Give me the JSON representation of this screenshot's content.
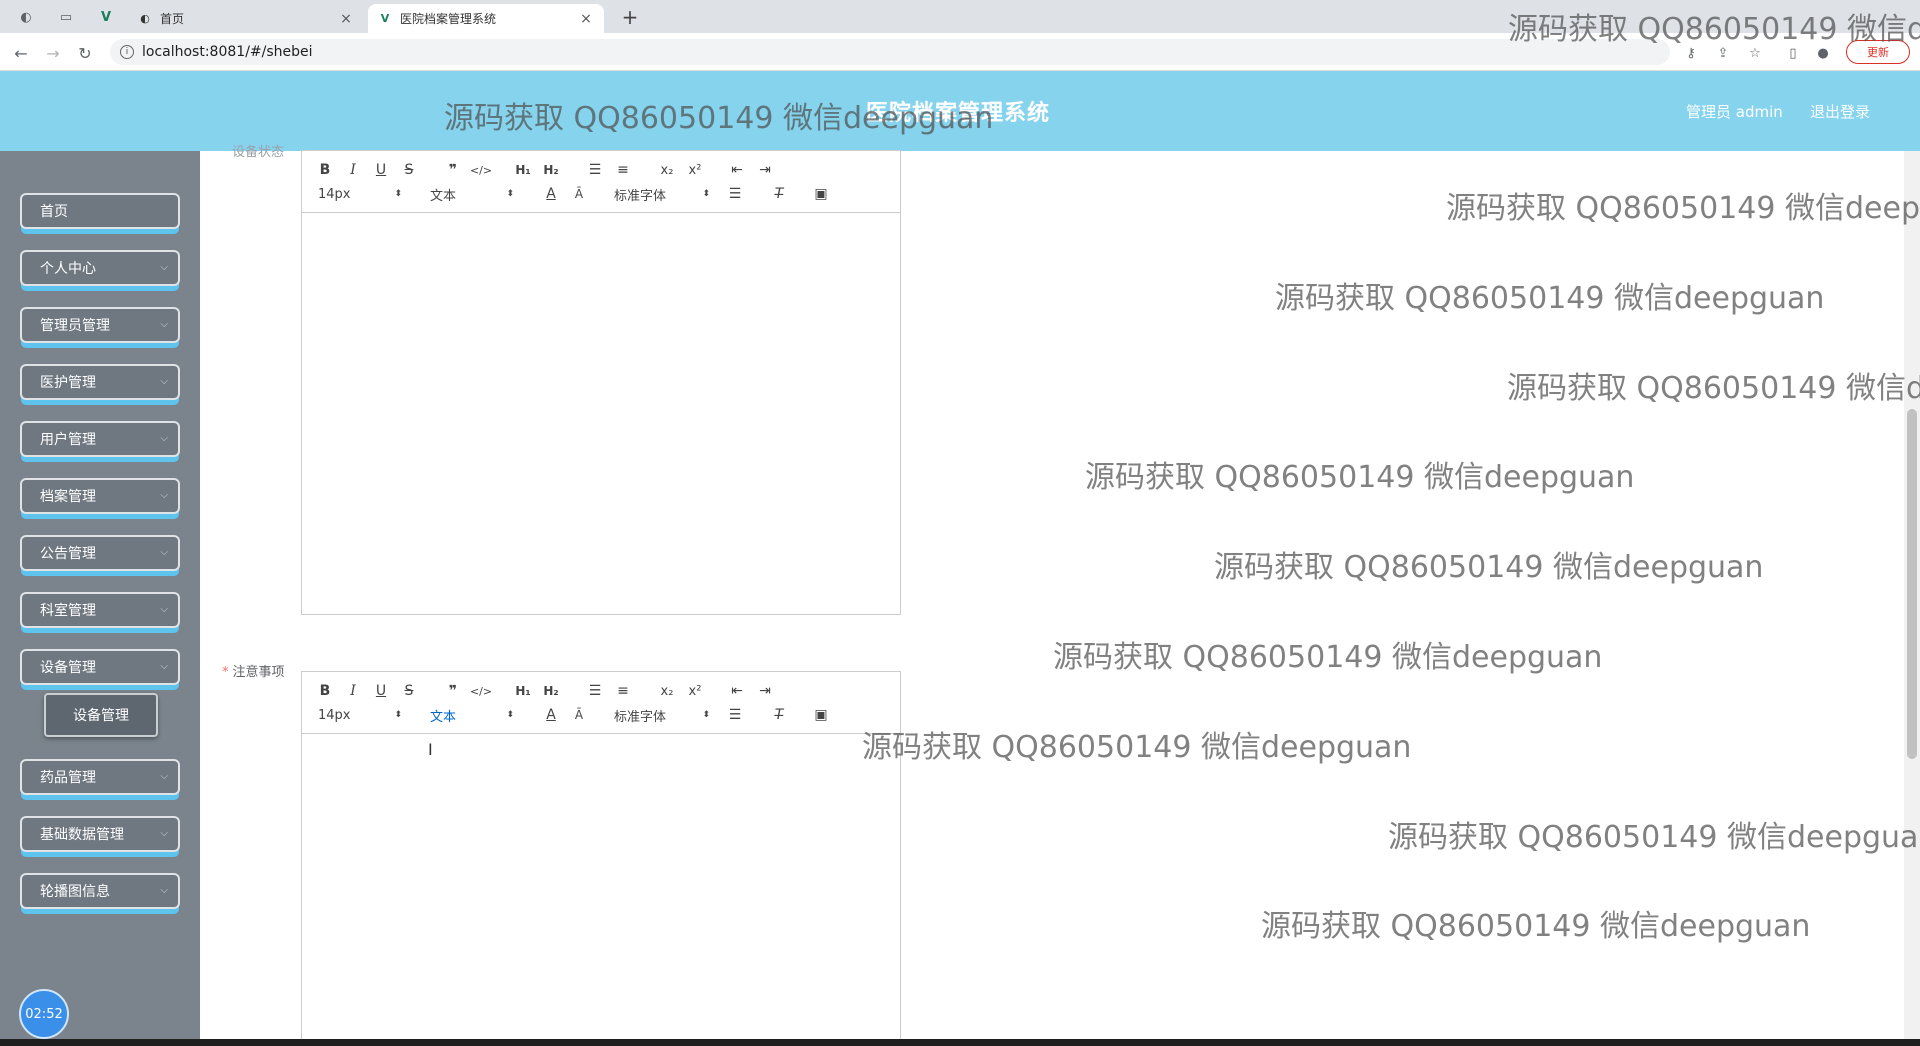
{
  "browser": {
    "tabs": [
      {
        "label": "首页"
      },
      {
        "label": "医院档案管理系统"
      }
    ],
    "url": "localhost:8081/#/shebei",
    "update_label": "更新"
  },
  "header": {
    "title": "医院档案管理系统",
    "user": "管理员 admin",
    "logout": "退出登录"
  },
  "sidebar": {
    "items": [
      {
        "label": "首页"
      },
      {
        "label": "个人中心"
      },
      {
        "label": "管理员管理"
      },
      {
        "label": "医护管理"
      },
      {
        "label": "用户管理"
      },
      {
        "label": "档案管理"
      },
      {
        "label": "公告管理"
      },
      {
        "label": "科室管理"
      },
      {
        "label": "设备管理"
      },
      {
        "label": "药品管理"
      },
      {
        "label": "基础数据管理"
      },
      {
        "label": "轮播图信息"
      }
    ],
    "submenu_active": "设备管理",
    "timer": "02:52"
  },
  "form": {
    "field1_label": "设备状态",
    "field2_label": "注意事项",
    "toolbar": {
      "font_size": "14px",
      "text_style": "文本",
      "font_family": "标准字体"
    }
  },
  "watermark": "源码获取 QQ86050149 微信deepguan"
}
